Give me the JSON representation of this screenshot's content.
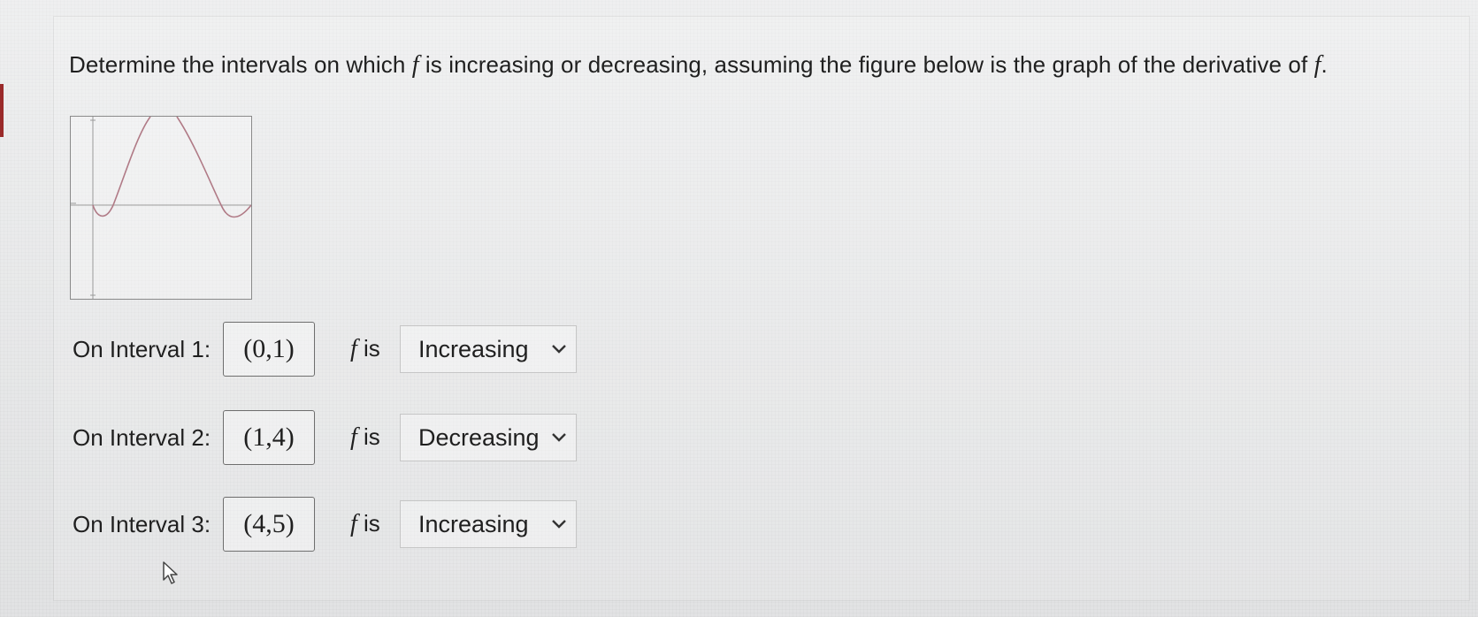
{
  "question": {
    "prefix": "Determine the intervals on which ",
    "var": "f",
    "middle": " is increasing or decreasing, assuming the figure below is the graph of the derivative of ",
    "suffix": "."
  },
  "graph": {
    "curve_color": "#b07a86",
    "axis_color": "#9a9a9a",
    "icon": "derivative-graph"
  },
  "rows": [
    {
      "label": "On Interval 1:",
      "interval": "(0,1)",
      "f": "f",
      "is_text": " is",
      "selected": "Increasing"
    },
    {
      "label": "On Interval 2:",
      "interval": "(1,4)",
      "f": "f",
      "is_text": " is",
      "selected": "Decreasing"
    },
    {
      "label": "On Interval 3:",
      "interval": "(4,5)",
      "f": "f",
      "is_text": " is",
      "selected": "Increasing"
    }
  ]
}
